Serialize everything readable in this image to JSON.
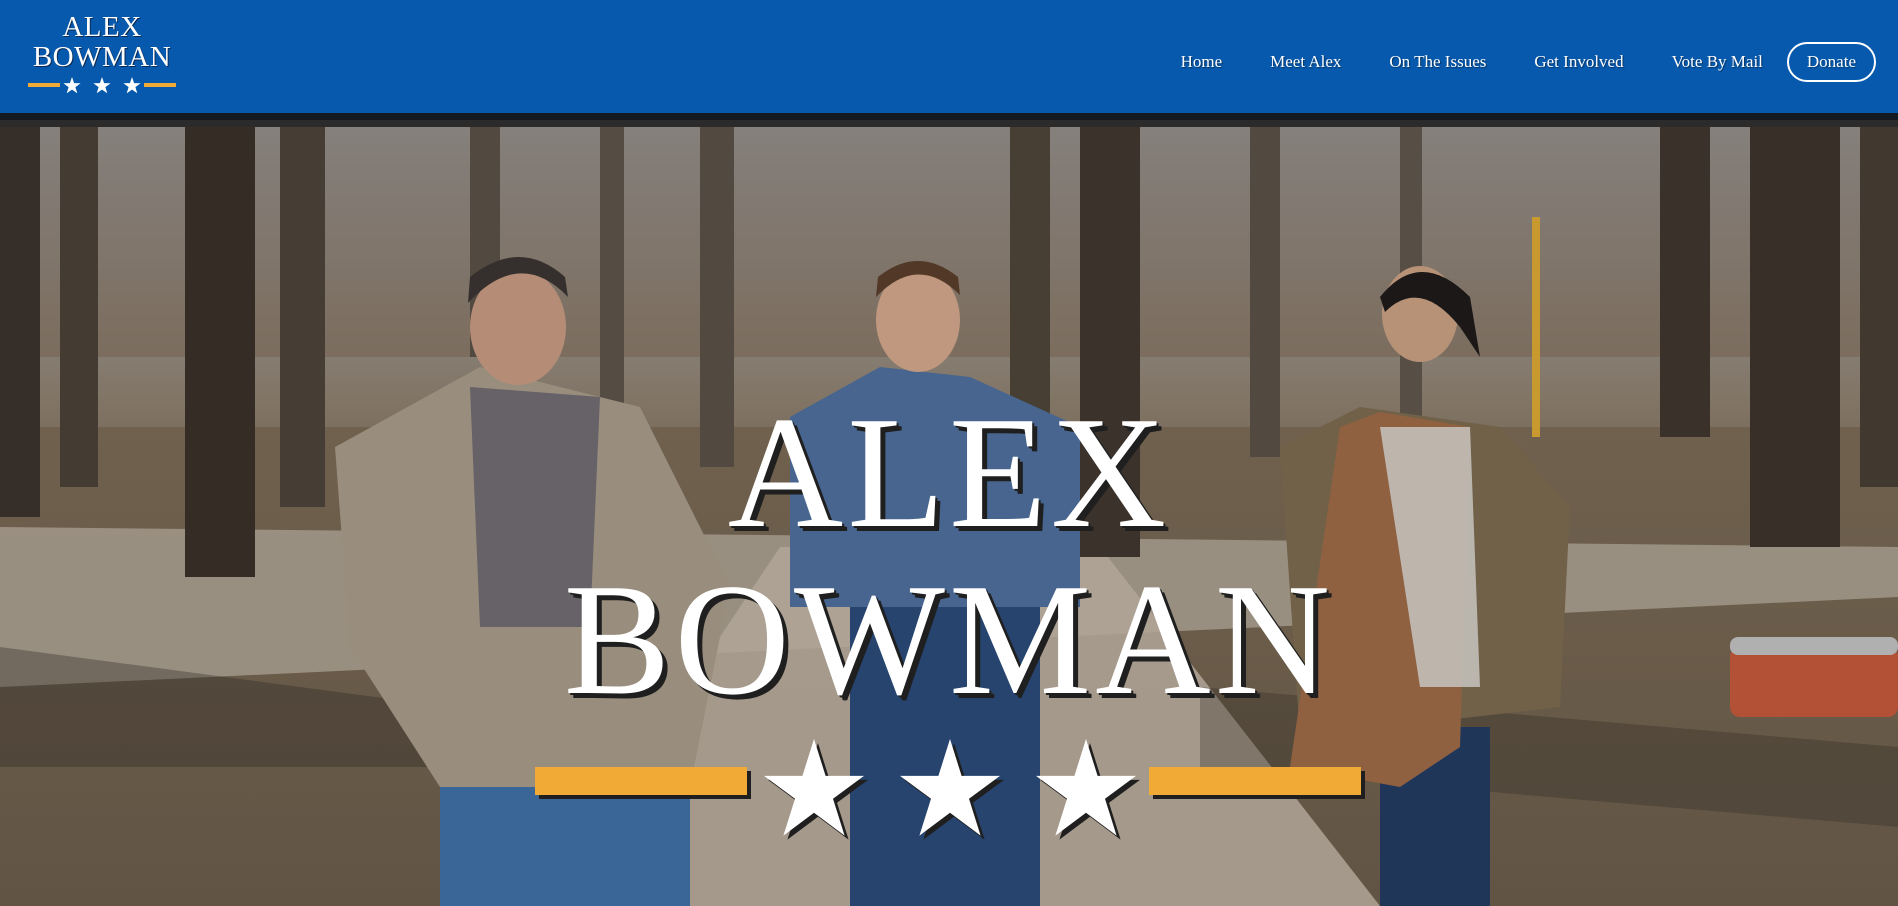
{
  "header": {
    "logo": {
      "line1": "ALEX",
      "line2": "BOWMAN",
      "icon": "three-stars-logo"
    },
    "nav": [
      "Home",
      "Meet Alex",
      "On The Issues",
      "Get Involved",
      "Vote By Mail"
    ],
    "donate_label": "Donate"
  },
  "hero": {
    "title_line1": "ALEX",
    "title_line2": "BOWMAN",
    "emblem_icon": "three-stars-with-bars",
    "photo": "three-people-walking-in-park"
  },
  "colors": {
    "header_bg": "#0759ad",
    "header_border": "#151a22",
    "accent_gold": "#f0aa35",
    "text": "#ffffff"
  }
}
